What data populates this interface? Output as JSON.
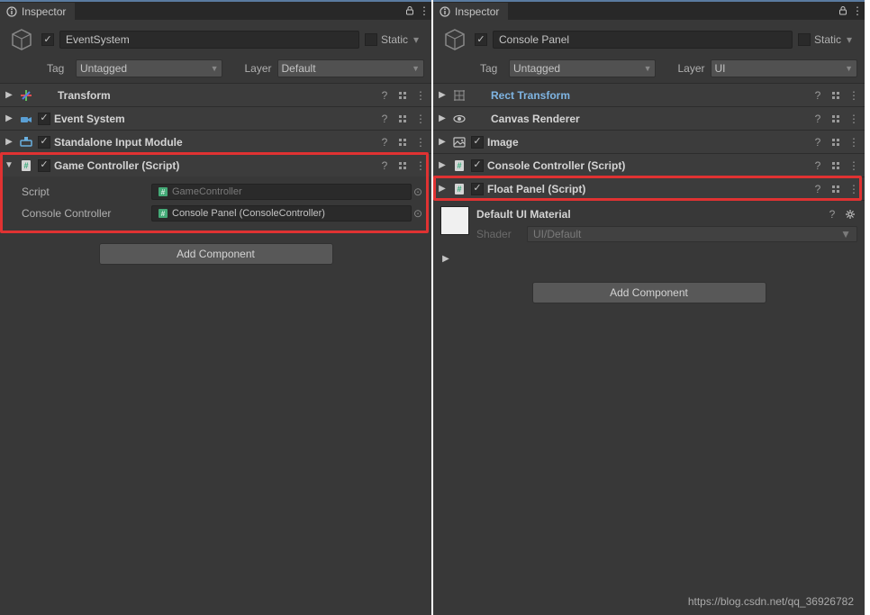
{
  "left": {
    "tab": "Inspector",
    "name": "EventSystem",
    "static": "Static",
    "tag_label": "Tag",
    "tag_value": "Untagged",
    "layer_label": "Layer",
    "layer_value": "Default",
    "components": [
      {
        "title": "Transform",
        "checked": null,
        "highlighted": false,
        "icon": "transform"
      },
      {
        "title": "Event System",
        "checked": true,
        "highlighted": false,
        "icon": "event"
      },
      {
        "title": "Standalone Input Module",
        "checked": true,
        "highlighted": false,
        "icon": "input"
      },
      {
        "title": "Game Controller (Script)",
        "checked": true,
        "highlighted": false,
        "icon": "script",
        "expanded": true
      }
    ],
    "props": [
      {
        "label": "Script",
        "value": "GameController",
        "icon": "script",
        "locked": true
      },
      {
        "label": "Console Controller",
        "value": "Console Panel (ConsoleController)",
        "icon": "script",
        "picker": true
      }
    ],
    "add_label": "Add Component"
  },
  "right": {
    "tab": "Inspector",
    "name": "Console Panel",
    "static": "Static",
    "tag_label": "Tag",
    "tag_value": "Untagged",
    "layer_label": "Layer",
    "layer_value": "UI",
    "components": [
      {
        "title": "Rect Transform",
        "checked": null,
        "highlighted": true,
        "icon": "rect"
      },
      {
        "title": "Canvas Renderer",
        "checked": null,
        "highlighted": false,
        "icon": "eye"
      },
      {
        "title": "Image",
        "checked": true,
        "highlighted": false,
        "icon": "image"
      },
      {
        "title": "Console Controller (Script)",
        "checked": true,
        "highlighted": false,
        "icon": "script"
      },
      {
        "title": "Float Panel (Script)",
        "checked": true,
        "highlighted": false,
        "icon": "script"
      }
    ],
    "material": {
      "name": "Default UI Material",
      "shader_label": "Shader",
      "shader_value": "UI/Default"
    },
    "add_label": "Add Component"
  },
  "watermark": "https://blog.csdn.net/qq_36926782"
}
